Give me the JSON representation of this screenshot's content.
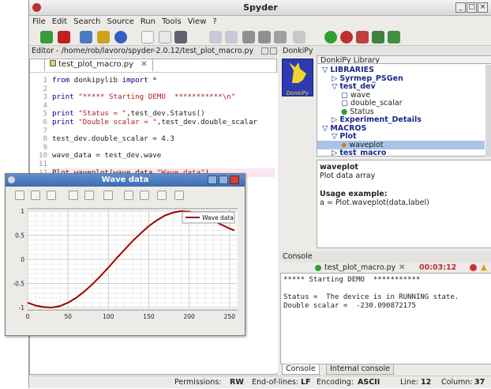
{
  "app": {
    "title": "Spyder"
  },
  "menu": [
    "File",
    "Edit",
    "Search",
    "Source",
    "Run",
    "Tools",
    "View",
    "?"
  ],
  "editor": {
    "path": "Editor - /home/rob/lavoro/spyder-2.0.12/test_plot_macro.py",
    "tab": "test_plot_macro.py",
    "lines": [
      {
        "n": "1",
        "code": "from donkipylib import *"
      },
      {
        "n": "2",
        "code": ""
      },
      {
        "n": "3",
        "code": "print \"***** Starting DEMO  ***********\\n\""
      },
      {
        "n": "4",
        "code": ""
      },
      {
        "n": "5",
        "code": "print \"Status = \",test_dev.Status()"
      },
      {
        "n": "6",
        "code": "print \"Double scalar = \",test_dev.double_scalar"
      },
      {
        "n": "7",
        "code": ""
      },
      {
        "n": "8",
        "code": "test_dev.double_scalar = 4.3"
      },
      {
        "n": "9",
        "code": ""
      },
      {
        "n": "10",
        "code": "wave_data = test_dev.wave"
      },
      {
        "n": "11",
        "code": ""
      },
      {
        "n": "12",
        "code": "Plot.waveplot(wave_data,\"Wave data\")"
      }
    ]
  },
  "donkipy": {
    "pane_title": "DonkiPy",
    "logo_text": "DonkiPy",
    "library_header": "DonkiPy Library",
    "tree": [
      {
        "label": "LIBRARIES",
        "indent": 0,
        "glyph": "▽",
        "bold": true
      },
      {
        "label": "Syrmep_PSGen",
        "indent": 1,
        "glyph": "▷",
        "bold": true
      },
      {
        "label": "test_dev",
        "indent": 1,
        "glyph": "▽",
        "bold": true
      },
      {
        "label": "wave",
        "indent": 2,
        "glyph": "▢",
        "bold": false
      },
      {
        "label": "double_scalar",
        "indent": 2,
        "glyph": "▢",
        "bold": false
      },
      {
        "label": "Status",
        "indent": 2,
        "glyph": "●",
        "bold": false
      },
      {
        "label": "Experiment_Details",
        "indent": 1,
        "glyph": "▷",
        "bold": true
      },
      {
        "label": "MACROS",
        "indent": 0,
        "glyph": "▽",
        "bold": true
      },
      {
        "label": "Plot",
        "indent": 1,
        "glyph": "▽",
        "bold": true
      },
      {
        "label": "waveplot",
        "indent": 2,
        "glyph": "◆",
        "bold": false,
        "selected": true
      },
      {
        "label": "test_macro",
        "indent": 1,
        "glyph": "▷",
        "bold": true
      }
    ],
    "help": {
      "func": "waveplot",
      "desc": "Plot data array",
      "usage_title": "Usage example:",
      "usage": "a = Plot.waveplot(data,label)"
    }
  },
  "console": {
    "pane_title": "Console",
    "tab": "test_plot_macro.py",
    "timer": "00:03:12",
    "lines": [
      "***** Starting DEMO  ***********",
      "",
      "Status =  The device is in RUNNING state.",
      "Double scalar =  -230.090872175"
    ],
    "bottom_tabs": [
      "Console",
      "Internal console"
    ]
  },
  "statusbar": {
    "perm_label": "Permissions:",
    "perm": "RW",
    "eol_label": "End-of-lines:",
    "eol": "LF",
    "enc_label": "Encoding:",
    "enc": "ASCII",
    "line_label": "Line:",
    "line": "12",
    "col_label": "Column:",
    "col": "37"
  },
  "plot": {
    "window_title": "Wave data",
    "chart_data": {
      "type": "line",
      "series": [
        {
          "name": "Wave data",
          "x": [
            0,
            10,
            20,
            30,
            40,
            50,
            60,
            70,
            80,
            90,
            100,
            110,
            120,
            130,
            140,
            150,
            160,
            170,
            180,
            190,
            200,
            210,
            220,
            230,
            240,
            250,
            256
          ],
          "values": [
            -0.9,
            -0.96,
            -0.99,
            -1.0,
            -0.97,
            -0.9,
            -0.8,
            -0.67,
            -0.52,
            -0.35,
            -0.17,
            0.02,
            0.2,
            0.38,
            0.54,
            0.69,
            0.81,
            0.91,
            0.97,
            1.0,
            0.99,
            0.95,
            0.88,
            0.8,
            0.72,
            0.64,
            0.6
          ]
        }
      ],
      "xlim": [
        0,
        260
      ],
      "ylim": [
        -1.05,
        1.05
      ],
      "xticks": [
        0,
        50,
        100,
        150,
        200,
        250
      ],
      "yticks": [
        -1,
        -0.5,
        0,
        0.5,
        1
      ],
      "ytick_labels": [
        "-1",
        "-0.5",
        "0",
        "0.5",
        "1"
      ],
      "grid": true,
      "legend": "top-right",
      "color": "#a00000"
    }
  }
}
